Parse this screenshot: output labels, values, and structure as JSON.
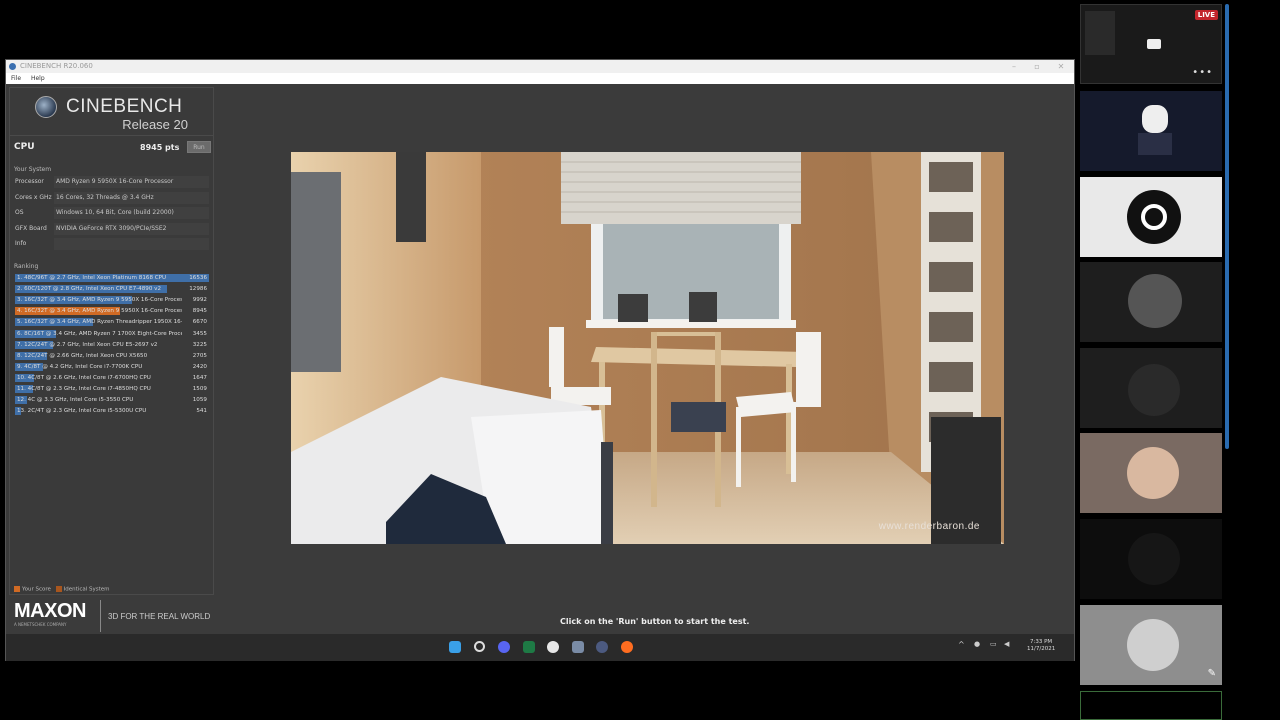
{
  "window": {
    "title": "CINEBENCH R20.060",
    "menu": [
      "File",
      "Help"
    ]
  },
  "logo": {
    "name": "CINEBENCH",
    "release": "Release 20"
  },
  "cpu": {
    "label": "CPU",
    "score": "8945 pts",
    "run_label": "Run"
  },
  "your_system": {
    "title": "Your System",
    "rows": [
      {
        "key": "Processor",
        "value": "AMD Ryzen 9 5950X 16-Core Processor"
      },
      {
        "key": "Cores x GHz",
        "value": "16 Cores, 32 Threads @ 3.4 GHz"
      },
      {
        "key": "OS",
        "value": "Windows 10, 64 Bit, Core (build 22000)"
      },
      {
        "key": "GFX Board",
        "value": "NVIDIA GeForce RTX 3090/PCIe/SSE2"
      },
      {
        "key": "Info",
        "value": ""
      }
    ]
  },
  "ranking": {
    "title": "Ranking",
    "rows": [
      {
        "text": "1. 48C/96T @ 2.7 GHz, Intel Xeon Platinum 8168 CPU",
        "score": "16536",
        "fraction": 1.0,
        "highlight": "blue"
      },
      {
        "text": "2. 60C/120T @ 2.8 GHz, Intel Xeon CPU E7-4890 v2",
        "score": "12986",
        "fraction": 0.785,
        "highlight": "blue"
      },
      {
        "text": "3. 16C/32T @ 3.4 GHz, AMD Ryzen 9 5950X 16-Core Process",
        "score": "9992",
        "fraction": 0.604,
        "highlight": "blue"
      },
      {
        "text": "4. 16C/32T @ 3.4 GHz, AMD Ryzen 9 5950X 16-Core Process",
        "score": "8945",
        "fraction": 0.541,
        "highlight": "orange"
      },
      {
        "text": "5. 16C/32T @ 3.4 GHz, AMD Ryzen Threadripper 1950X 16-C",
        "score": "6670",
        "fraction": 0.403,
        "highlight": "blue"
      },
      {
        "text": "6. 8C/16T @ 3.4 GHz, AMD Ryzen 7 1700X Eight-Core Proce:",
        "score": "3455",
        "fraction": 0.209,
        "highlight": "blue"
      },
      {
        "text": "7. 12C/24T @ 2.7 GHz, Intel Xeon CPU E5-2697 v2",
        "score": "3225",
        "fraction": 0.195,
        "highlight": "blue"
      },
      {
        "text": "8. 12C/24T @ 2.66 GHz, Intel Xeon CPU X5650",
        "score": "2705",
        "fraction": 0.164,
        "highlight": "blue"
      },
      {
        "text": "9. 4C/8T @ 4.2 GHz, Intel Core i7-7700K CPU",
        "score": "2420",
        "fraction": 0.146,
        "highlight": "blue"
      },
      {
        "text": "10. 4C/8T @ 2.6 GHz, Intel Core i7-6700HQ CPU",
        "score": "1647",
        "fraction": 0.1,
        "highlight": "blue"
      },
      {
        "text": "11. 4C/8T @ 2.3 GHz, Intel Core i7-4850HQ CPU",
        "score": "1509",
        "fraction": 0.091,
        "highlight": "blue"
      },
      {
        "text": "12. 4C @ 3.3 GHz, Intel Core i5-3550 CPU",
        "score": "1059",
        "fraction": 0.064,
        "highlight": "blue"
      },
      {
        "text": "13. 2C/4T @ 2.3 GHz, Intel Core i5-5300U CPU",
        "score": "541",
        "fraction": 0.033,
        "highlight": "blue"
      }
    ]
  },
  "legend": {
    "your_score": "Your Score",
    "identical": "Identical System"
  },
  "footer": {
    "brand": "MAXON",
    "brand_sub": "A NEMETSCHEK COMPANY",
    "tagline": "3D FOR THE REAL WORLD",
    "status": "Click on the 'Run' button to start the test."
  },
  "render": {
    "watermark": "www.renderbaron.de"
  },
  "taskbar": {
    "time": "7:33 PM",
    "date": "11/7/2021"
  },
  "stream": {
    "live_label": "LIVE",
    "more": "•••"
  },
  "colors": {
    "rank_blue": "#3f6fa8",
    "rank_orange": "#d06a24"
  }
}
